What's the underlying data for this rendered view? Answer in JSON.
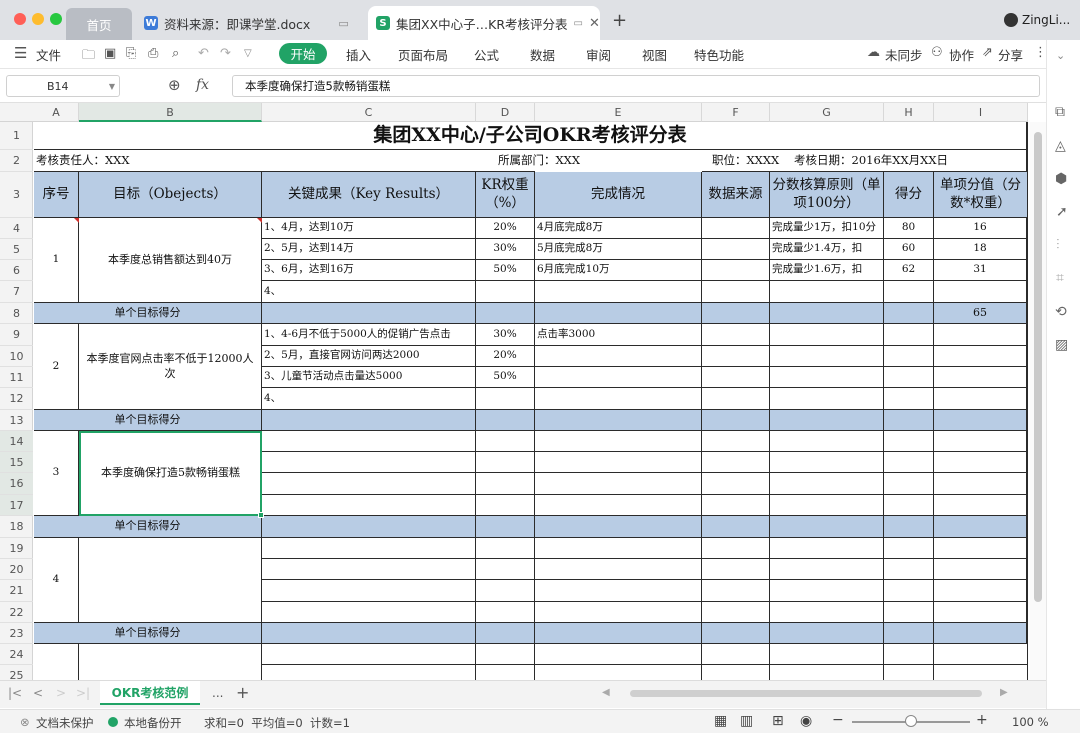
{
  "window": {
    "tabs": [
      {
        "label": "首页"
      },
      {
        "label": "资料来源：即课学堂.docx",
        "badge": "W"
      },
      {
        "label": "集团XX中心子…KR考核评分表",
        "badge": "S"
      }
    ],
    "new_tab": "+",
    "user": "ZingLi..."
  },
  "menu": {
    "file": "文件",
    "items": [
      "开始",
      "插入",
      "页面布局",
      "公式",
      "数据",
      "审阅",
      "视图",
      "特色功能"
    ],
    "sync": "未同步",
    "collab": "协作",
    "share": "分享"
  },
  "formula": {
    "cell_ref": "B14",
    "fx": "fx",
    "value": "本季度确保打造5款畅销蛋糕"
  },
  "columns": [
    "A",
    "B",
    "C",
    "D",
    "E",
    "F",
    "G",
    "H",
    "I"
  ],
  "rows": [
    "1",
    "2",
    "3",
    "4",
    "5",
    "6",
    "7",
    "8",
    "9",
    "10",
    "11",
    "12",
    "13",
    "14",
    "15",
    "16",
    "17",
    "18",
    "19",
    "20",
    "21",
    "22",
    "23",
    "24",
    "25"
  ],
  "sheet": {
    "title": "集团XX中心/子公司OKR考核评分表",
    "info": {
      "owner": "考核责任人：XXX",
      "dept": "所属部门：XXX",
      "position": "职位：XXXX",
      "date": "考核日期：2016年XX月XX日"
    },
    "headers": [
      "序号",
      "目标（Obejects）",
      "关键成果（Key Results）",
      "KR权重（%）",
      "完成情况",
      "数据来源",
      "分数核算原则（单项100分）",
      "得分",
      "单项分值（分数*权重）"
    ],
    "subtotal_label": "单个目标得分",
    "groups": [
      {
        "no": "1",
        "objective": "本季度总销售额达到40万",
        "krs": [
          {
            "kr": "1、4月，达到10万",
            "weight": "20%",
            "status": "4月底完成8万",
            "rule": "完成量少1万，扣10分",
            "score": "80",
            "value": "16"
          },
          {
            "kr": "2、5月，达到14万",
            "weight": "30%",
            "status": "5月底完成8万",
            "rule": "完成量少1.4万，扣",
            "score": "60",
            "value": "18"
          },
          {
            "kr": "3、6月，达到16万",
            "weight": "50%",
            "status": "6月底完成10万",
            "rule": "完成量少1.6万，扣",
            "score": "62",
            "value": "31"
          },
          {
            "kr": "4、",
            "weight": "",
            "status": "",
            "rule": "",
            "score": "",
            "value": ""
          }
        ],
        "subtotal": "65"
      },
      {
        "no": "2",
        "objective": "本季度官网点击率不低于12000人次",
        "krs": [
          {
            "kr": "1、4-6月不低于5000人的促销广告点击",
            "weight": "30%",
            "status": "点击率3000",
            "rule": "",
            "score": "",
            "value": ""
          },
          {
            "kr": "2、5月，直接官网访问两达2000",
            "weight": "20%",
            "status": "",
            "rule": "",
            "score": "",
            "value": ""
          },
          {
            "kr": "3、儿童节活动点击量达5000",
            "weight": "50%",
            "status": "",
            "rule": "",
            "score": "",
            "value": ""
          },
          {
            "kr": "4、",
            "weight": "",
            "status": "",
            "rule": "",
            "score": "",
            "value": ""
          }
        ],
        "subtotal": ""
      },
      {
        "no": "3",
        "objective": "本季度确保打造5款畅销蛋糕",
        "krs": [
          {
            "kr": "",
            "weight": "",
            "status": "",
            "rule": "",
            "score": "",
            "value": ""
          },
          {
            "kr": "",
            "weight": "",
            "status": "",
            "rule": "",
            "score": "",
            "value": ""
          },
          {
            "kr": "",
            "weight": "",
            "status": "",
            "rule": "",
            "score": "",
            "value": ""
          },
          {
            "kr": "",
            "weight": "",
            "status": "",
            "rule": "",
            "score": "",
            "value": ""
          }
        ],
        "subtotal": ""
      },
      {
        "no": "4",
        "objective": "",
        "krs": [
          {
            "kr": "",
            "weight": "",
            "status": "",
            "rule": "",
            "score": "",
            "value": ""
          },
          {
            "kr": "",
            "weight": "",
            "status": "",
            "rule": "",
            "score": "",
            "value": ""
          },
          {
            "kr": "",
            "weight": "",
            "status": "",
            "rule": "",
            "score": "",
            "value": ""
          },
          {
            "kr": "",
            "weight": "",
            "status": "",
            "rule": "",
            "score": "",
            "value": ""
          }
        ],
        "subtotal": ""
      }
    ]
  },
  "sheet_tabs": {
    "active": "OKR考核范例",
    "more": "...",
    "add": "+"
  },
  "status": {
    "protect": "文档未保护",
    "backup": "本地备份开",
    "stats": "求和=0  平均值=0  计数=1",
    "zoom": "100 %"
  },
  "colors": {
    "header_fill": "#b8cce4",
    "accent_green": "#21a366",
    "selection": "#21a366"
  }
}
